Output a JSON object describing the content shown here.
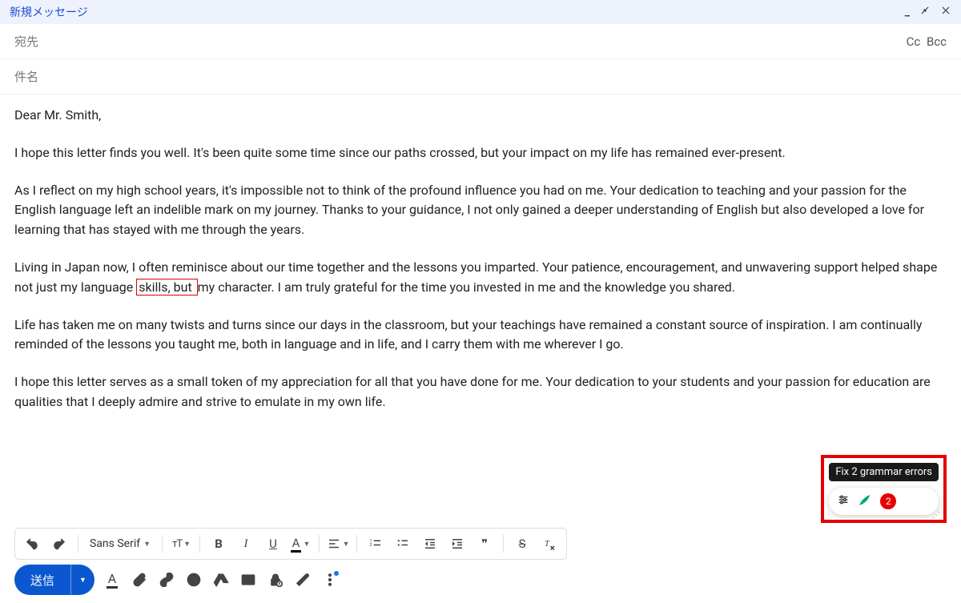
{
  "header": {
    "title": "新規メッセージ"
  },
  "recipients": {
    "placeholder": "宛先",
    "cc": "Cc",
    "bcc": "Bcc"
  },
  "subject": {
    "placeholder": "件名"
  },
  "body": {
    "p1": "Dear Mr. Smith,",
    "p2": "I hope this letter finds you well. It's been quite some time since our paths crossed, but your impact on my life has remained ever-present.",
    "p3": "As I reflect on my high school years, it's impossible not to think of the profound influence you had on me. Your dedication to teaching and your passion for the English language left an indelible mark on my journey. Thanks to your guidance, I not only gained a deeper understanding of English but also developed a love for learning that has stayed with me through the years.",
    "p4_a": "Living in Japan now, I often reminisce about our time together and the lessons you imparted. Your patience, encouragement, and unwavering support helped shape not just my language ",
    "p4_hl": "skills, but ",
    "p4_b": "my character. I am truly grateful for the time you invested in me and the knowledge you shared.",
    "p5": "Life has taken me on many twists and turns since our days in the classroom, but your teachings have remained a constant source of inspiration. I am continually reminded of the lessons you taught me, both in language and in life, and I carry them with me wherever I go.",
    "p6": "I hope this letter serves as a small token of my appreciation for all that you have done for me. Your dedication to your students and your passion for education are qualities that I deeply admire and strive to emulate in my own life."
  },
  "grammar": {
    "tooltip": "Fix 2 grammar errors",
    "count": "2"
  },
  "toolbar": {
    "font": "Sans Serif",
    "size_icon": "тT",
    "bold": "B",
    "italic": "I",
    "underline": "U",
    "color": "A",
    "quote": "❞"
  },
  "send": {
    "label": "送信",
    "font_color": "A"
  }
}
